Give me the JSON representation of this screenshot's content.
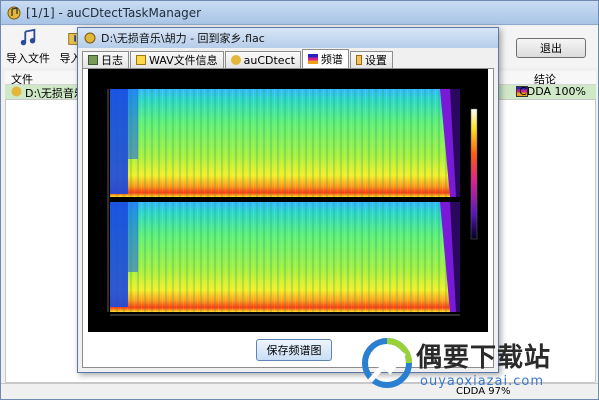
{
  "main_window": {
    "title": "[1/1] - auCDtectTaskManager",
    "toolbar": {
      "import_file": "导入文件",
      "import_folder": "导入文",
      "exit": "退出"
    },
    "list": {
      "col_file": "文件",
      "col_result": "结论",
      "rows": [
        {
          "file": "D:\\无损音乐\\",
          "result": "CDDA 100%"
        }
      ]
    },
    "status_text": "CDDA 97%"
  },
  "dialog": {
    "title": "D:\\无损音乐\\胡力 - 回到家乡.flac",
    "tabs": [
      {
        "label": "日志",
        "icon": "log-icon"
      },
      {
        "label": "WAV文件信息",
        "icon": "info-icon"
      },
      {
        "label": "auCDtect",
        "icon": "aucdtect-icon"
      },
      {
        "label": "频谱",
        "icon": "spectrum-icon",
        "active": true
      },
      {
        "label": "设置",
        "icon": "settings-icon"
      }
    ],
    "save_button": "保存频谱图"
  },
  "watermark": {
    "brand_cn": "偶要下载站",
    "brand_url": "ouyaoxiazai.com"
  },
  "colors": {
    "title_bar": "#b6cde9",
    "selected_row": "#cfe8c6",
    "spectrum_bg": "#000000"
  }
}
